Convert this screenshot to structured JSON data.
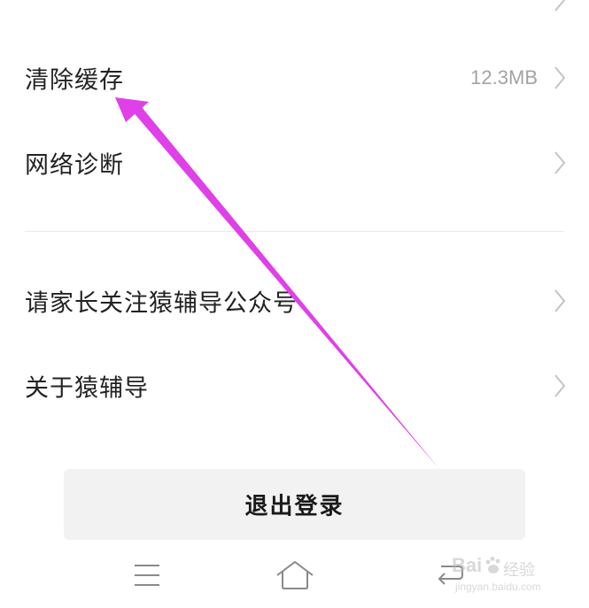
{
  "settings": {
    "items": [
      {
        "label": "",
        "value": ""
      },
      {
        "label": "清除缓存",
        "value": "12.3MB"
      },
      {
        "label": "网络诊断",
        "value": ""
      },
      {
        "label": "请家长关注猿辅导公众号",
        "value": ""
      },
      {
        "label": "关于猿辅导",
        "value": ""
      }
    ]
  },
  "logout": {
    "label": "退出登录"
  },
  "navbar": {
    "icons": [
      "menu-icon",
      "home-icon",
      "back-icon"
    ]
  },
  "watermark": {
    "brand": "Bai",
    "sub": "经验",
    "url": "jingyan.baidu.com"
  },
  "annotation": {
    "color": "#e040e8"
  },
  "colors": {
    "text": "#222222",
    "secondary": "#a3a3a3",
    "button_bg": "#f2f2f2",
    "divider": "#e9e9e9"
  }
}
